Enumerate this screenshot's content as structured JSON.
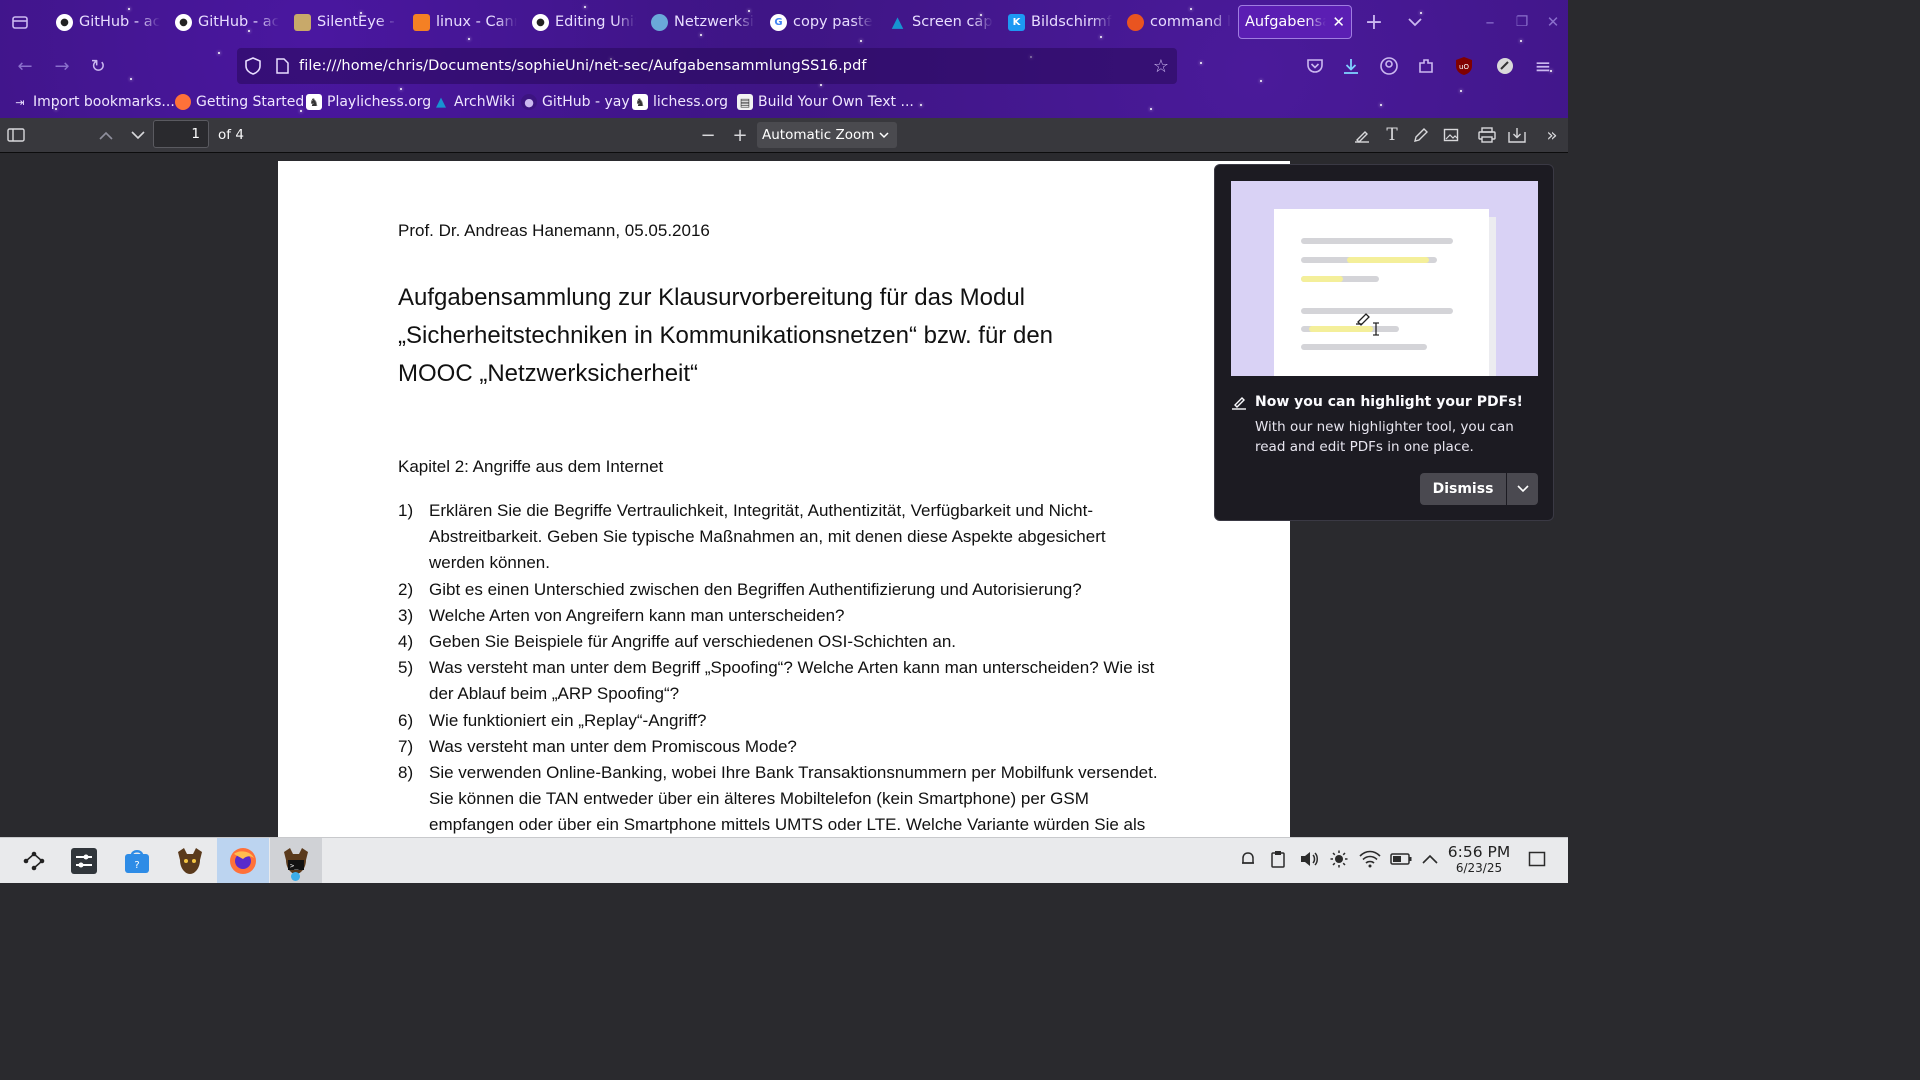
{
  "tabs": [
    {
      "label": "GitHub - acl",
      "icon": "github-icon",
      "active": false
    },
    {
      "label": "GitHub - acl",
      "icon": "github-icon",
      "active": false
    },
    {
      "label": "SilentEye - S",
      "icon": "silenteye-icon",
      "active": false
    },
    {
      "label": "linux - Cann",
      "icon": "stackoverflow-icon",
      "active": false
    },
    {
      "label": "Editing UniS",
      "icon": "github-icon",
      "active": false
    },
    {
      "label": "Netzwerksic",
      "icon": "globe-icon",
      "active": false
    },
    {
      "label": "copy paste",
      "icon": "google-icon",
      "active": false
    },
    {
      "label": "Screen capt",
      "icon": "archwiki-icon",
      "active": false
    },
    {
      "label": "Bildschirmf",
      "icon": "kde-icon",
      "active": false
    },
    {
      "label": "command li",
      "icon": "askubuntu-icon",
      "active": false
    },
    {
      "label": "Aufgabensar",
      "icon": "pdf-icon",
      "active": true
    }
  ],
  "url": "file:///home/chris/Documents/sophieUni/net-sec/AufgabensammlungSS16.pdf",
  "bookmarks": [
    {
      "label": "Import bookmarks...",
      "icon": "import-icon"
    },
    {
      "label": "Getting Started",
      "icon": "firefox-icon"
    },
    {
      "label": "Playlichess.org",
      "icon": "lichess-icon"
    },
    {
      "label": "ArchWiki",
      "icon": "archwiki-icon"
    },
    {
      "label": "GitHub - yay",
      "icon": "github-icon"
    },
    {
      "label": "lichess.org",
      "icon": "lichess-icon"
    },
    {
      "label": "Build Your Own Text ...",
      "icon": "page-icon"
    }
  ],
  "pdf_toolbar": {
    "page_number": "1",
    "page_count": "of 4",
    "zoom": "Automatic Zoom"
  },
  "document": {
    "author_line": "Prof. Dr. Andreas Hanemann, 05.05.2016",
    "title_lines": [
      "Aufgabensammlung zur Klausurvorbereitung für das Modul",
      "„Sicherheitstechniken in Kommunikationsnetzen“ bzw. für den",
      "MOOC „Netzwerksicherheit“"
    ],
    "chapter": "Kapitel 2: Angriffe aus dem Internet",
    "questions": [
      {
        "num": "1)",
        "lines": [
          "Erklären Sie die Begriffe Vertraulichkeit, Integrität, Authentizität, Verfügbarkeit und Nicht-",
          "Abstreitbarkeit. Geben Sie typische Maßnahmen an, mit denen diese Aspekte abgesichert",
          "werden können."
        ]
      },
      {
        "num": "2)",
        "lines": [
          "Gibt es einen Unterschied zwischen den Begriffen Authentifizierung und Autorisierung?"
        ]
      },
      {
        "num": "3)",
        "lines": [
          "Welche Arten von Angreifern kann man unterscheiden?"
        ]
      },
      {
        "num": "4)",
        "lines": [
          "Geben Sie Beispiele für Angriffe auf verschiedenen OSI-Schichten an."
        ]
      },
      {
        "num": "5)",
        "lines": [
          "Was versteht man unter dem Begriff „Spoofing“? Welche Arten kann man unterscheiden? Wie ist",
          "der Ablauf beim „ARP Spoofing“?"
        ]
      },
      {
        "num": "6)",
        "lines": [
          "Wie funktioniert ein „Replay“-Angriff?"
        ]
      },
      {
        "num": "7)",
        "lines": [
          "Was versteht man unter dem Promiscous Mode?"
        ]
      },
      {
        "num": "8)",
        "lines": [
          "Sie verwenden Online-Banking, wobei Ihre Bank Transaktionsnummern per Mobilfunk versendet.",
          "Sie können die TAN entweder über ein älteres Mobiltelefon (kein Smartphone) per GSM",
          "empfangen oder über ein Smartphone mittels UMTS oder LTE. Welche Variante würden Sie als"
        ]
      }
    ]
  },
  "popup": {
    "title": "Now you can highlight your PDFs!",
    "body": "With our new highlighter tool, you can read and edit PDFs in one place.",
    "dismiss_label": "Dismiss"
  },
  "taskbar": {
    "time": "6:56 PM",
    "date": "6/23/25"
  },
  "colors": {
    "chrome_purple": "#3c1480",
    "active_tab": "#5b1eb3",
    "pdf_toolbar": "#38383d",
    "popup_bg": "#1c1b22",
    "highlight_yellow": "#f4ef9a",
    "taskbar_bg": "#e9eaec"
  }
}
